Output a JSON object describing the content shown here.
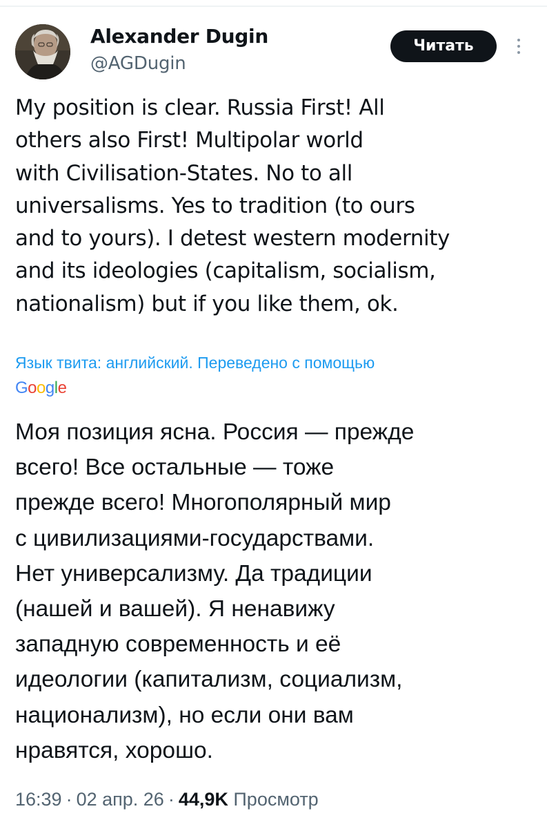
{
  "author": {
    "display_name": "Alexander Dugin",
    "handle": "@AGDugin"
  },
  "follow_button": {
    "label": "Читать"
  },
  "more_icon": "vertical-ellipsis-icon",
  "tweet": {
    "lines": [
      "My position is clear. Russia First! All",
      "others also First! Multipolar world",
      "with Civilisation-States. No to all",
      "universalisms. Yes to tradition (to ours",
      "and to yours). I detest western modernity",
      "and its ideologies (capitalism, socialism,",
      "nationalism) but if you like them, ok."
    ]
  },
  "translation": {
    "note": "Язык твита: английский. Переведено с помощью",
    "provider": "Google",
    "lines": [
      "Моя позиция ясна. Россия — прежде",
      "всего! Все остальные — тоже",
      "прежде всего! Многополярный мир",
      "с цивилизациями-государствами.",
      "Нет универсализму. Да традиции",
      "(нашей и вашей). Я ненавижу",
      "западную современность и её",
      "идеологии (капитализм, социализм,",
      "национализм), но если они вам",
      "нравятся, хорошо."
    ]
  },
  "meta": {
    "time": "16:39",
    "date": "02 апр. 26",
    "separator": "·",
    "views_count": "44,9K",
    "views_label": "Просмотр"
  },
  "colors": {
    "text": "#0f1419",
    "secondary": "#536471",
    "link": "#1d9bf0",
    "button_bg": "#0f1419"
  }
}
